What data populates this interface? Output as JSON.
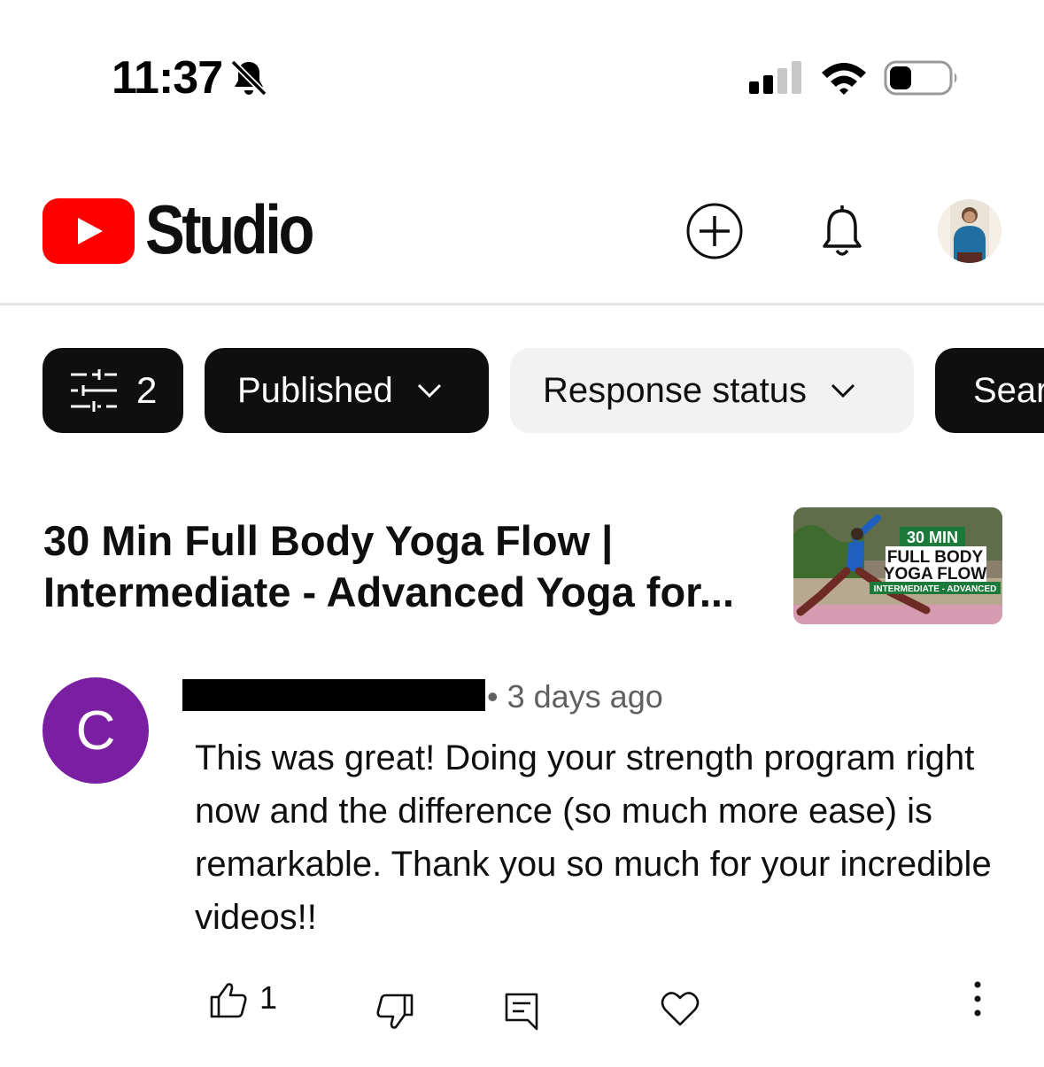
{
  "status_bar": {
    "time": "11:37",
    "icons": [
      "bell-off-icon",
      "cellular-signal-icon",
      "wifi-icon",
      "battery-icon"
    ]
  },
  "header": {
    "logo_text": "Studio",
    "icons": [
      "youtube-logo-icon",
      "create-plus-icon",
      "notifications-bell-icon",
      "account-avatar"
    ]
  },
  "filters": {
    "filter_count": "2",
    "chips": [
      {
        "label": "Published",
        "icon": "chevron-down-icon"
      },
      {
        "label": "Response status",
        "icon": "chevron-down-icon"
      },
      {
        "label": "Sear"
      }
    ]
  },
  "video": {
    "title": "30 Min Full Body Yoga Flow | Intermediate - Advanced Yoga for...",
    "thumbnail": {
      "line1": "30 MIN",
      "line2": "FULL BODY",
      "line3": "YOGA FLOW",
      "line4": "INTERMEDIATE - ADVANCED"
    }
  },
  "comment": {
    "avatar_letter": "C",
    "time": "• 3 days ago",
    "text": "This was great! Doing your strength program right now and the difference (so much more ease) is remarkable. Thank you so much for your incredible videos!!",
    "like_count": "1"
  },
  "colors": {
    "youtube_red": "#ff0000",
    "chip_dark": "#0f0f0f",
    "chip_light": "#f2f2f2",
    "comment_avatar": "#7b1fa2",
    "thumb_green": "#1b7a3a"
  }
}
